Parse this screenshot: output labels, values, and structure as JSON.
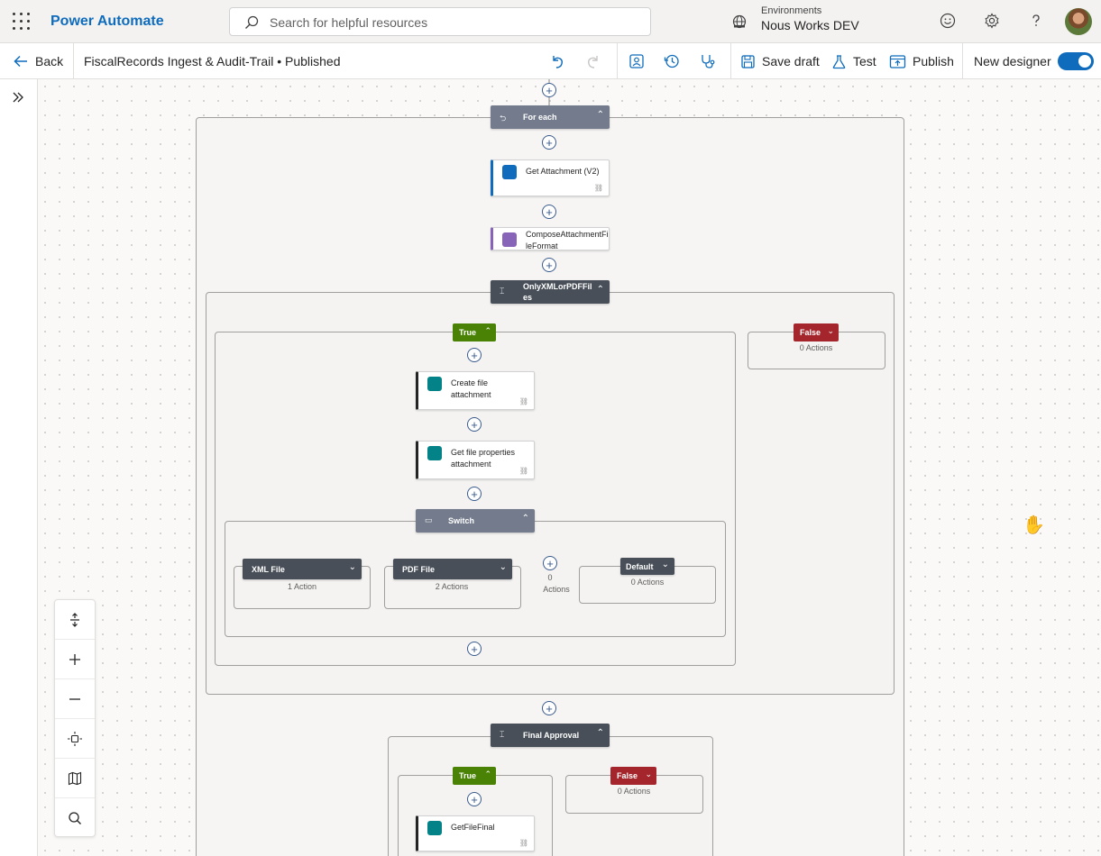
{
  "app": {
    "name": "Power Automate"
  },
  "search": {
    "placeholder": "Search for helpful resources"
  },
  "environment": {
    "label": "Environments",
    "name": "Nous Works DEV"
  },
  "commandbar": {
    "back_label": "Back",
    "flow_title": "FiscalRecords Ingest & Audit-Trail • Published",
    "save_draft_label": "Save draft",
    "test_label": "Test",
    "publish_label": "Publish",
    "new_designer_label": "New designer",
    "new_designer_on": true
  },
  "flow": {
    "for_each": {
      "title": "For each"
    },
    "get_attachment": {
      "title": "Get Attachment (V2)"
    },
    "compose": {
      "title": "ComposeAttachmentFileFormat"
    },
    "condition1": {
      "title": "OnlyXMLorPDFFiles"
    },
    "true_label": "True",
    "false_label": "False",
    "false_count": "0 Actions",
    "create_file": {
      "title": "Create file attachment"
    },
    "get_props": {
      "title": "Get file properties attachment"
    },
    "switch": {
      "title": "Switch"
    },
    "case_xml": {
      "title": "XML File",
      "count": "1 Action"
    },
    "case_pdf": {
      "title": "PDF File",
      "count": "2 Actions"
    },
    "case_add_count": "0",
    "case_add_count_label": "Actions",
    "case_default": {
      "title": "Default",
      "count": "0 Actions"
    },
    "final_approval": {
      "title": "Final Approval"
    },
    "final_true_label": "True",
    "final_false_label": "False",
    "final_false_count": "0 Actions",
    "get_file_final": {
      "title": "GetFileFinal"
    }
  },
  "colors": {
    "brand": "#0f6cbd",
    "true_green": "#498205",
    "false_red": "#a4262c",
    "scope_header": "#737b8c",
    "condition_header": "#484f58"
  },
  "icons": {
    "apps": "waffle-icon",
    "search": "search-icon",
    "environment": "globe-icon",
    "feedback": "smiley-icon",
    "settings": "gear-icon",
    "help": "help-icon",
    "undo": "undo-icon",
    "redo": "redo-icon",
    "copilot": "copilot-icon",
    "history": "history-icon",
    "checker": "stethoscope-icon",
    "save": "save-icon",
    "test": "flask-icon",
    "publish": "publish-icon",
    "expand": "expand-icon",
    "zoom_in": "zoom-in-icon",
    "zoom_out": "zoom-out-icon",
    "fit": "fit-view-icon",
    "minimap": "map-icon",
    "find": "find-icon",
    "pan": "hand-icon"
  }
}
